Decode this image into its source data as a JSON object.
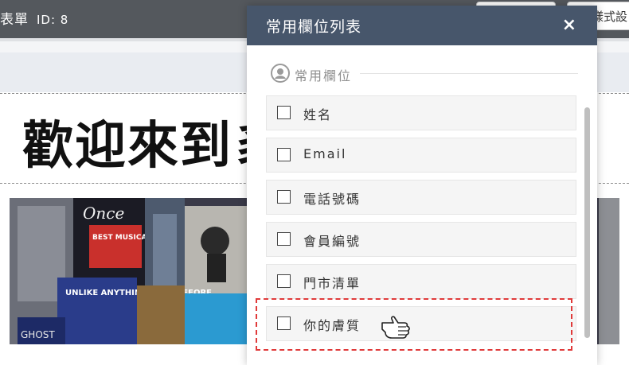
{
  "header": {
    "title": "表單",
    "id_label": "ID: 8",
    "right_button_label": "樣式設"
  },
  "canvas": {
    "headline": "歡迎來到豸"
  },
  "photo": {
    "sign_once": "Once",
    "sign_best": "BEST MUSICAL",
    "sign_unlike": "UNLIKE ANYTHING SEEN BEFORE",
    "sign_ghost": "GHOST"
  },
  "modal": {
    "title": "常用欄位列表",
    "close_label": "×",
    "section_label": "常用欄位",
    "fields": [
      "姓名",
      "Email",
      "電話號碼",
      "會員編號",
      "門市清單",
      "你的膚質"
    ],
    "highlighted_field": "你的膚質"
  },
  "colors": {
    "modal_header": "#47566b",
    "highlight": "#e03a3a",
    "topbar": "#54585d"
  }
}
